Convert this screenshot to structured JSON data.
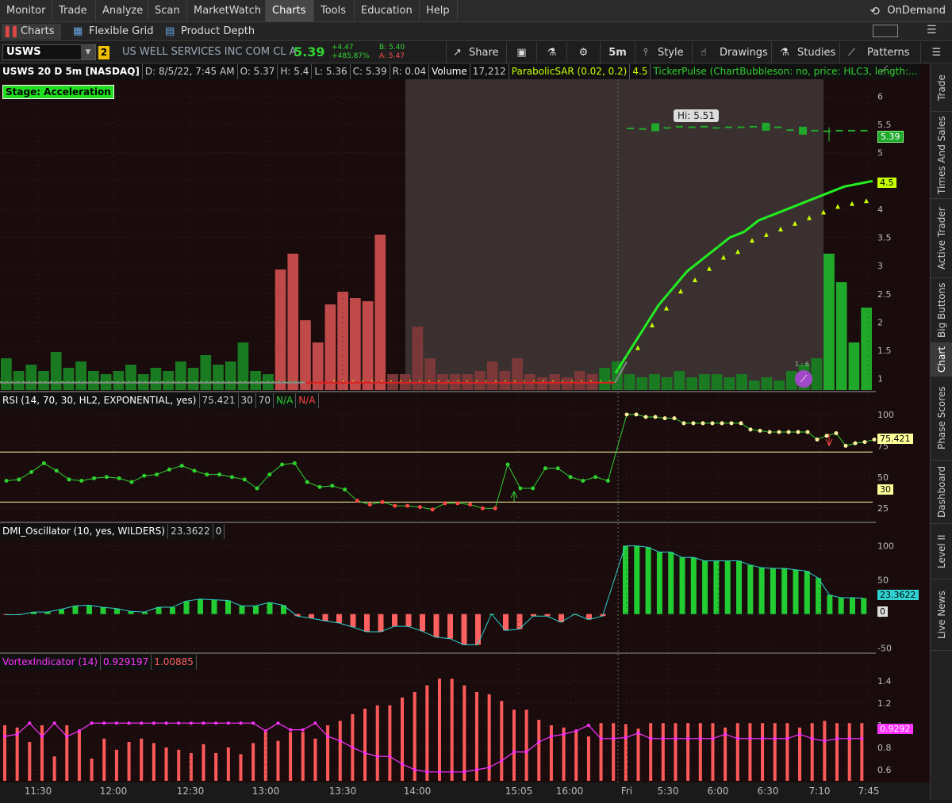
{
  "menubar": {
    "items": [
      "Monitor",
      "Trade",
      "Analyze",
      "Scan",
      "MarketWatch",
      "Charts",
      "Tools",
      "Education",
      "Help"
    ],
    "active": "Charts",
    "ondemand": "OnDemand"
  },
  "subtabs": {
    "charts": "Charts",
    "flexible_grid": "Flexible Grid",
    "product_depth": "Product Depth"
  },
  "toolbar": {
    "symbol": "USWS",
    "link_number": "2",
    "company": "US WELL SERVICES INC COM CL A",
    "last": "5.39",
    "net_change": "+4.47",
    "pct_change": "+485.87%",
    "bid": "B: 5.40",
    "ask": "A: 5.47",
    "share": "Share",
    "timeframe": "5m",
    "style": "Style",
    "drawings": "Drawings",
    "studies": "Studies",
    "patterns": "Patterns"
  },
  "price_panel": {
    "header": {
      "symbol": "USWS 20 D 5m [NASDAQ]",
      "date": "D: 8/5/22, 7:45 AM",
      "open": "O: 5.37",
      "high": "H: 5.4",
      "low": "L: 5.36",
      "close": "C: 5.39",
      "range": "R: 0.04",
      "volume_label": "Volume",
      "volume": "17,212",
      "psar": "ParabolicSAR (0.02, 0.2)",
      "psar_val": "4.5",
      "tickerpulse": "TickerPulse (ChartBubbleson: no, price: HLC3, length:..."
    },
    "stage_label": "Stage: Acceleration",
    "hi_bubble": "Hi: 5.51",
    "price_tag": "5.39",
    "sar_tag": "4.5",
    "y_ticks": [
      "6",
      "5.5",
      "5",
      "4.5",
      "4",
      "3.5",
      "3",
      "2.5",
      "2",
      "1.5",
      "1"
    ],
    "pattern_label": "1 : 6"
  },
  "rsi_panel": {
    "header": {
      "name": "RSI (14, 70, 30, HL2, EXPONENTIAL, yes)",
      "value": "75.421",
      "ob": "30",
      "os": "70",
      "na1": "N/A",
      "na2": "N/A"
    },
    "y_ticks": [
      "100",
      "75",
      "50",
      "25"
    ],
    "tag": "75.421",
    "tag30": "30"
  },
  "dmi_panel": {
    "header": {
      "name": "DMI_Oscillator (10, yes, WILDERS)",
      "value": "23.3622",
      "zero": "0"
    },
    "y_ticks": [
      "100",
      "50",
      "0",
      "-50"
    ],
    "tag": "23.3622",
    "tag0": "0"
  },
  "vortex_panel": {
    "header": {
      "name": "VortexIndicator (14)",
      "v1": "0.929197",
      "v2": "1.00885"
    },
    "y_ticks": [
      "1.4",
      "1.2",
      "1",
      "0.8",
      "0.6"
    ],
    "tag": "0.9292"
  },
  "x_ticks": [
    "11:30",
    "12:00",
    "12:30",
    "13:00",
    "13:30",
    "14:00",
    "15:05",
    "16:00",
    "Fri",
    "5:30",
    "6:00",
    "6:30",
    "7:10",
    "7:45"
  ],
  "right_tabs": [
    "Trade",
    "Times And Sales",
    "Active Trader",
    "Big Buttons",
    "Chart",
    "Phase Scores",
    "Dashboard",
    "Level II",
    "Live News"
  ],
  "colors": {
    "up": "#1fa82a",
    "down": "#e05a5a",
    "sar": "#c8ff00",
    "rsi": "#2fd12f",
    "vortex": "#ff33ff",
    "bg": "#1a0c0c"
  },
  "chart_data": [
    {
      "type": "bar",
      "title": "Volume",
      "values": [
        1,
        0.6,
        0.8,
        0.6,
        1.2,
        0.7,
        0.9,
        0.6,
        0.5,
        0.6,
        0.8,
        0.5,
        0.7,
        0.6,
        0.9,
        0.7,
        1.1,
        0.8,
        0.9,
        1.5,
        0.6,
        0.5,
        3.8,
        4.3,
        2.2,
        1.5,
        2.7,
        3.1,
        2.9,
        2.8,
        4.9,
        0.5,
        0.5,
        2,
        1,
        0.5,
        0.5,
        0.5,
        0.6,
        0.9,
        0.6,
        1,
        0.5,
        0.4,
        0.5,
        0.4,
        0.6,
        0.5,
        0.7,
        0.9,
        0.5,
        0.4,
        0.5,
        0.4,
        0.6,
        0.4,
        0.5,
        0.5,
        0.4,
        0.5,
        0.3,
        0.4,
        0.3,
        0.6,
        0.8,
        1,
        4.3,
        3.4,
        1.5,
        2.6
      ]
    },
    {
      "type": "line",
      "title": "Price",
      "y_range": [
        0.8,
        6.3
      ],
      "values": [
        0.93,
        0.93,
        0.93,
        0.93,
        0.93,
        0.93,
        0.93,
        0.93,
        0.93,
        0.93,
        0.93,
        0.93,
        0.93,
        0.93,
        0.93,
        0.93,
        0.93,
        0.93,
        0.93,
        0.93,
        0.93,
        0.93,
        0.93,
        0.93,
        0.93,
        0.93,
        0.93,
        0.93,
        0.93,
        0.93,
        0.93,
        0.93,
        0.93,
        0.93,
        0.93,
        0.93,
        0.93,
        0.93,
        0.93,
        0.93,
        0.93,
        0.93,
        0.93,
        0.93,
        0.93,
        0.93,
        0.93,
        0.93,
        0.93,
        5.43,
        5.42,
        5.45,
        5.44,
        5.46,
        5.45,
        5.46,
        5.44,
        5.45,
        5.45,
        5.46,
        5.46,
        5.45,
        5.4,
        5.39,
        5.39,
        5.38,
        5.39,
        5.39,
        5.39
      ]
    },
    {
      "type": "line",
      "title": "ParabolicSAR",
      "values": [
        1.1,
        1.5,
        1.9,
        2.3,
        2.6,
        2.9,
        3.1,
        3.3,
        3.5,
        3.6,
        3.8,
        3.9,
        4,
        4.1,
        4.2,
        4.3,
        4.4,
        4.45,
        4.5
      ]
    },
    {
      "type": "line",
      "title": "RSI",
      "y_range": [
        15,
        105
      ],
      "values": [
        47,
        48,
        54,
        61,
        55,
        48,
        47,
        49,
        50,
        49,
        46,
        51,
        52,
        56,
        59,
        55,
        52,
        52,
        50,
        48,
        41,
        52,
        60,
        61,
        46,
        42,
        43,
        40,
        31,
        28,
        30,
        27,
        27,
        26,
        24,
        29,
        29,
        28,
        25,
        25,
        60,
        41,
        41,
        57,
        57,
        50,
        47,
        50,
        47,
        100,
        100,
        98,
        98,
        97,
        97,
        93,
        93,
        93,
        93,
        93,
        93,
        93,
        88,
        87,
        86,
        86,
        86,
        86,
        86,
        80,
        83,
        85,
        75,
        77,
        78,
        80
      ]
    },
    {
      "type": "bar",
      "title": "DMI_Oscillator",
      "y_range": [
        -55,
        110
      ],
      "values": [
        -1,
        -1,
        3,
        3,
        7,
        12,
        13,
        10,
        8,
        4,
        3,
        10,
        10,
        19,
        22,
        21,
        20,
        12,
        12,
        17,
        13,
        -3,
        -6,
        -10,
        -13,
        -19,
        -26,
        -26,
        -18,
        -18,
        -25,
        -34,
        -36,
        -45,
        -45,
        0,
        -24,
        -22,
        -3,
        -3,
        -12,
        0,
        -8,
        -3,
        100,
        100,
        98,
        91,
        91,
        83,
        83,
        78,
        78,
        78,
        78,
        72,
        68,
        67,
        67,
        65,
        63,
        53,
        28,
        24,
        24,
        23.36
      ]
    },
    {
      "type": "bar",
      "title": "Vortex",
      "y_range": [
        0.5,
        1.5
      ],
      "values": [
        1,
        0.98,
        0.85,
        1,
        0.72,
        1,
        0.95,
        0.7,
        0.88,
        0.78,
        0.85,
        0.88,
        0.84,
        0.8,
        0.78,
        0.75,
        0.83,
        0.75,
        0.8,
        0.74,
        0.84,
        0.95,
        0.86,
        0.94,
        0.94,
        0.88,
        1,
        1.04,
        1.1,
        1.15,
        1.18,
        1.18,
        1.25,
        1.3,
        1.36,
        1.42,
        1.42,
        1.36,
        1.3,
        1.28,
        1.22,
        1.14,
        1.14,
        1.05,
        1,
        0.98,
        0.95,
        0.9,
        1.02,
        1.02,
        1.01,
        0.97,
        1.02,
        1.02,
        1.02,
        1.02,
        1.02,
        1.02,
        0.98,
        1.02,
        1.02,
        1.02,
        1.02,
        1.02,
        0.98,
        1.02,
        1.04,
        1.02,
        1.02,
        1.02
      ]
    }
  ]
}
